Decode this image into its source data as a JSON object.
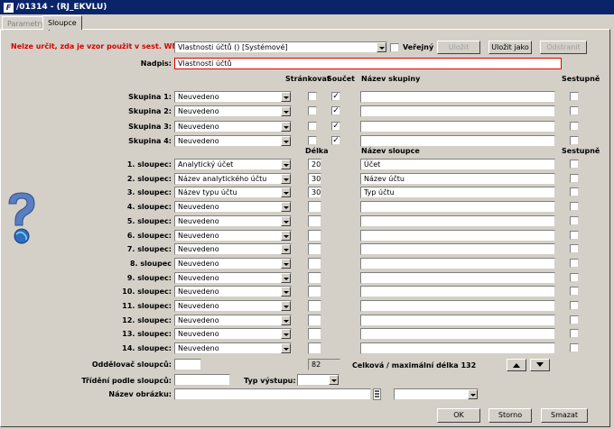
{
  "window": {
    "title": "/01314 - (RJ_EKVLU)",
    "icon": "app-icon"
  },
  "tabs": [
    {
      "label": "Parametry",
      "active": false
    },
    {
      "label": "Sloupce",
      "active": true
    }
  ],
  "template": {
    "warning": "Nelze určit, zda je vzor použit v sest. WM.",
    "value": "Vlastnosti účtů   ()   [Systémové]",
    "public_label": "Veřejný",
    "save_label": "Uložit",
    "save_as_label": "Uložit jako",
    "remove_label": "Odstranit"
  },
  "heading": {
    "label": "Nadpis:",
    "value": "Vlastnosti účtů"
  },
  "groups": {
    "headers": {
      "paging": "Stránkovat",
      "sum": "Součet",
      "name": "Název skupiny",
      "desc": "Sestupně"
    },
    "rows": [
      {
        "label": "Skupina 1:",
        "value": "Neuvedeno",
        "paging": false,
        "sum": true,
        "name": "",
        "desc": false
      },
      {
        "label": "Skupina 2:",
        "value": "Neuvedeno",
        "paging": false,
        "sum": true,
        "name": "",
        "desc": false
      },
      {
        "label": "Skupina 3:",
        "value": "Neuvedeno",
        "paging": false,
        "sum": true,
        "name": "",
        "desc": false
      },
      {
        "label": "Skupina 4:",
        "value": "Neuvedeno",
        "paging": false,
        "sum": true,
        "name": "",
        "desc": false
      }
    ]
  },
  "columns": {
    "headers": {
      "length": "Délka",
      "name": "Název sloupce",
      "desc": "Sestupně"
    },
    "rows": [
      {
        "label": "1. sloupec:",
        "value": "Analytický účet",
        "length": "20",
        "name": "Účet"
      },
      {
        "label": "2. sloupec:",
        "value": "Název analytického účtu",
        "length": "30",
        "name": "Název účtu"
      },
      {
        "label": "3. sloupec:",
        "value": "Název typu účtu",
        "length": "30",
        "name": "Typ účtu"
      },
      {
        "label": "4. sloupec:",
        "value": "Neuvedeno",
        "length": "",
        "name": ""
      },
      {
        "label": "5. sloupec:",
        "value": "Neuvedeno",
        "length": "",
        "name": ""
      },
      {
        "label": "6. sloupec:",
        "value": "Neuvedeno",
        "length": "",
        "name": ""
      },
      {
        "label": "7. sloupec:",
        "value": "Neuvedeno",
        "length": "",
        "name": ""
      },
      {
        "label": "8. sloupec",
        "value": "Neuvedeno",
        "length": "",
        "name": ""
      },
      {
        "label": "9. sloupec:",
        "value": "Neuvedeno",
        "length": "",
        "name": ""
      },
      {
        "label": "10. sloupec:",
        "value": "Neuvedeno",
        "length": "",
        "name": ""
      },
      {
        "label": "11. sloupec:",
        "value": "Neuvedeno",
        "length": "",
        "name": ""
      },
      {
        "label": "12. sloupec:",
        "value": "Neuvedeno",
        "length": "",
        "name": ""
      },
      {
        "label": "13. sloupec:",
        "value": "Neuvedeno",
        "length": "",
        "name": ""
      },
      {
        "label": "14. sloupec:",
        "value": "Neuvedeno",
        "length": "",
        "name": ""
      }
    ]
  },
  "separator": {
    "label": "Oddělovač sloupců:",
    "value": ""
  },
  "total_length": {
    "value": "82",
    "label": "Celková / maximální délka 132"
  },
  "sort": {
    "label": "Třídění podle sloupců:",
    "value": ""
  },
  "output_type": {
    "label": "Typ výstupu:",
    "value": ""
  },
  "picture": {
    "label": "Název obrázku:",
    "value": "",
    "value2": ""
  },
  "footer": {
    "ok_label": "OK",
    "cancel_label": "Storno",
    "delete_label": "Smazat"
  },
  "colors": {
    "titlebar": "#0a246a",
    "warning": "#d40000",
    "face": "#d4d0c8"
  }
}
